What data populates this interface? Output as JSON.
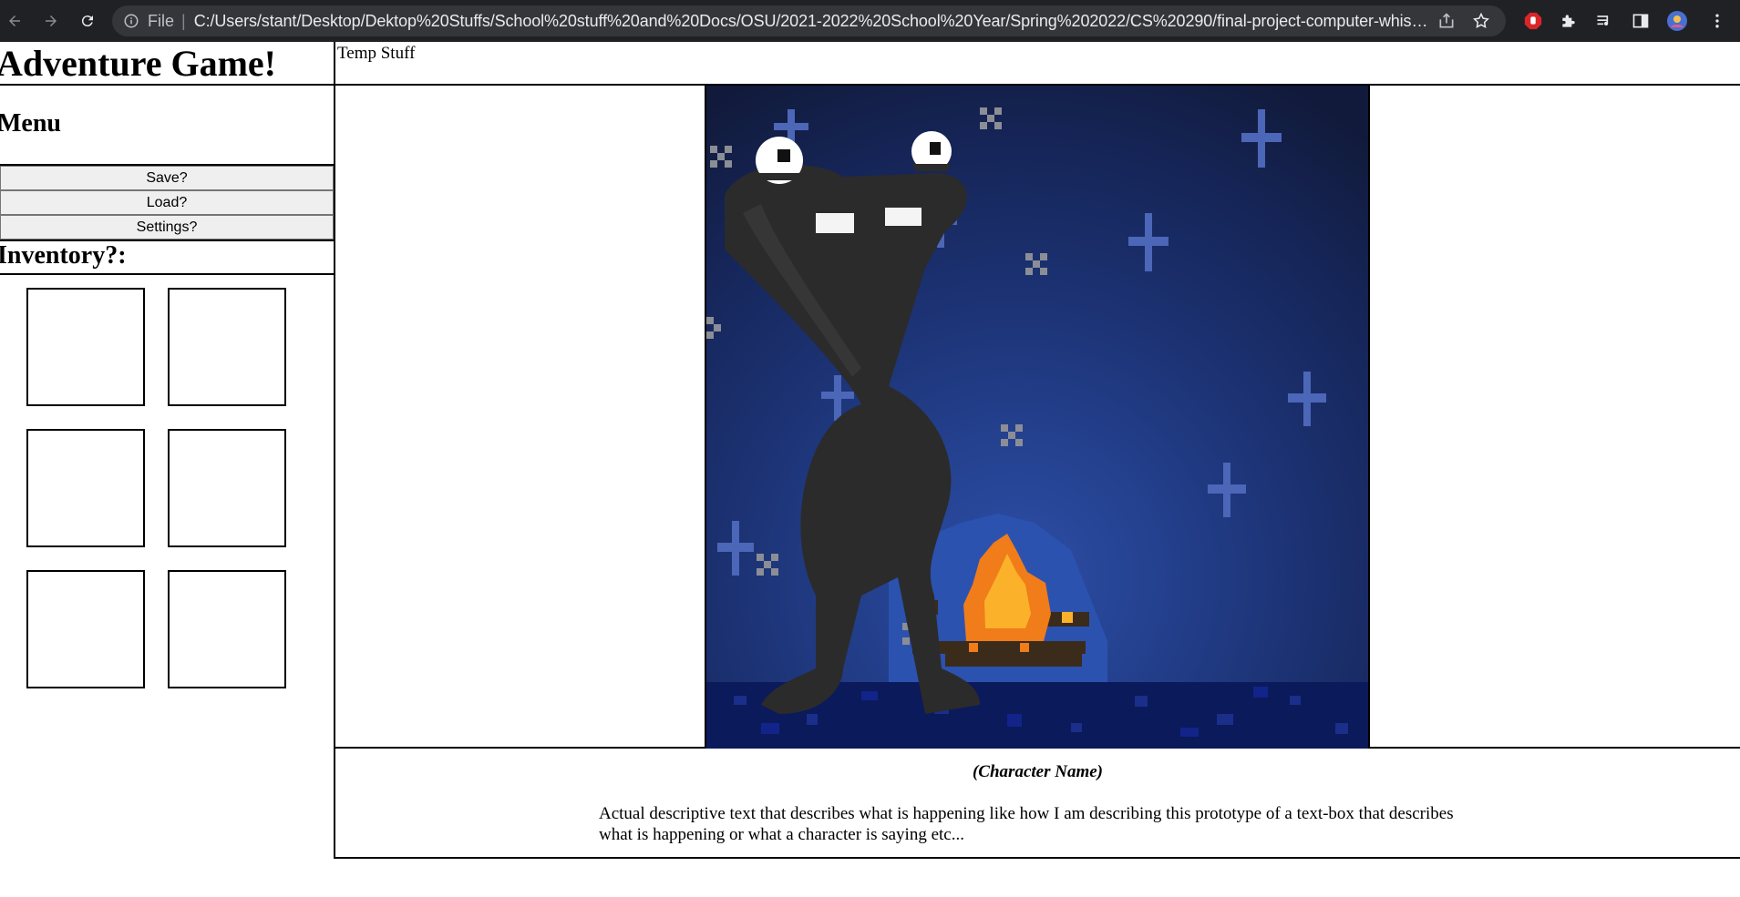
{
  "browser": {
    "scheme": "File",
    "url": "C:/Users/stant/Desktop/Dektop%20Stuffs/School%20stuff%20and%20Docs/OSU/2021-2022%20School%20Year/Spring%202022/CS%20290/final-project-computer-whisperer..."
  },
  "game": {
    "title": "Adventure Game!",
    "menu_heading": "Menu",
    "menu_items": [
      "Save?",
      "Load?",
      "Settings?"
    ],
    "inventory_heading": "Inventory?:",
    "inventory_slot_count": 6
  },
  "topbar": {
    "text": "Temp Stuff"
  },
  "scene": {
    "image": "pixel-art night scene: dark creature by a campfire under starry sky"
  },
  "dialogue": {
    "character_name": "(Character Name)",
    "text": "Actual descriptive text that describes what is happening like how I am describing this prototype of a text-box that describes what is happening or what a character is saying etc..."
  },
  "colors": {
    "chrome_bg": "#202124",
    "omnibox_bg": "#35363a",
    "sky_dark": "#111a38",
    "sky_mid": "#1f3470",
    "ground": "#0b1a5a",
    "creature": "#2b2b2b",
    "fire_outer": "#f07c1a",
    "fire_inner": "#fbb22a",
    "star_blue": "#4c66b8"
  }
}
